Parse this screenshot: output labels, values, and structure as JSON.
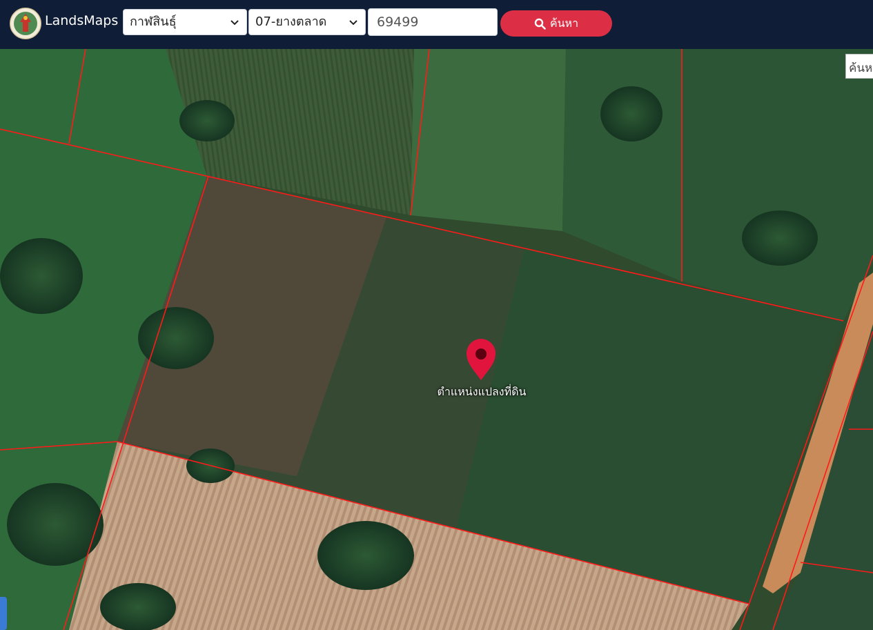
{
  "app": {
    "title": "LandsMaps"
  },
  "search": {
    "province": "กาฬสินธุ์",
    "district": "07-ยางตลาด",
    "parcel_number": "69499",
    "button_label": "ค้นหา",
    "map_search_placeholder": "ค้นห"
  },
  "map": {
    "marker_label": "ตำแหน่งแปลงที่ดิน",
    "marker_color": "#e0143c",
    "boundary_color": "#ff1a1a"
  },
  "colors": {
    "topbar": "#0f1d36",
    "search_button": "#dc2f45"
  }
}
